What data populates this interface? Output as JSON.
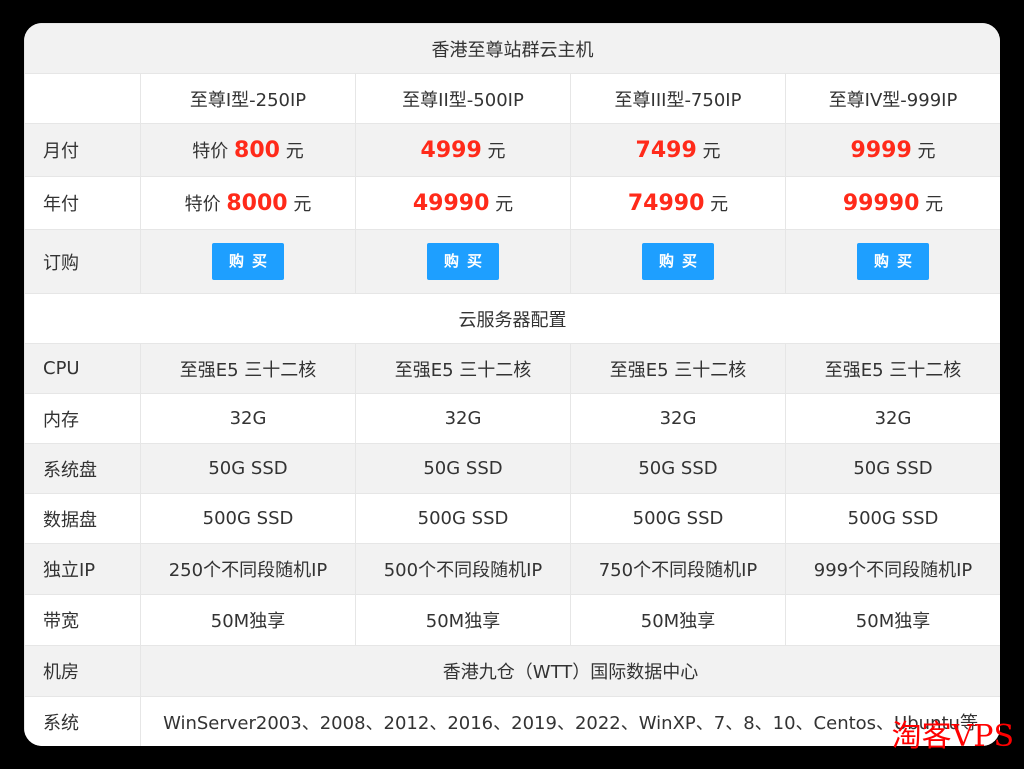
{
  "header": {
    "title": "香港至尊站群云主机"
  },
  "plans": [
    {
      "name": "至尊I型-250IP",
      "monthly_prefix": "特价",
      "monthly": "800",
      "yearly_prefix": "特价",
      "yearly": "8000",
      "buy": "购买",
      "cpu": "至强E5 三十二核",
      "ram": "32G",
      "sysdisk": "50G SSD",
      "datadisk": "500G SSD",
      "ip": "250个不同段随机IP",
      "bw": "50M独享"
    },
    {
      "name": "至尊II型-500IP",
      "monthly_prefix": "",
      "monthly": "4999",
      "yearly_prefix": "",
      "yearly": "49990",
      "buy": "购买",
      "cpu": "至强E5 三十二核",
      "ram": "32G",
      "sysdisk": "50G SSD",
      "datadisk": "500G SSD",
      "ip": "500个不同段随机IP",
      "bw": "50M独享"
    },
    {
      "name": "至尊III型-750IP",
      "monthly_prefix": "",
      "monthly": "7499",
      "yearly_prefix": "",
      "yearly": "74990",
      "buy": "购买",
      "cpu": "至强E5 三十二核",
      "ram": "32G",
      "sysdisk": "50G SSD",
      "datadisk": "500G SSD",
      "ip": "750个不同段随机IP",
      "bw": "50M独享"
    },
    {
      "name": "至尊IV型-999IP",
      "monthly_prefix": "",
      "monthly": "9999",
      "yearly_prefix": "",
      "yearly": "99990",
      "buy": "购买",
      "cpu": "至强E5 三十二核",
      "ram": "32G",
      "sysdisk": "50G SSD",
      "datadisk": "500G SSD",
      "ip": "999个不同段随机IP",
      "bw": "50M独享"
    }
  ],
  "labels": {
    "monthly": "月付",
    "yearly": "年付",
    "order": "订购",
    "cpu": "CPU",
    "ram": "内存",
    "sysdisk": "系统盘",
    "datadisk": "数据盘",
    "ip": "独立IP",
    "bw": "带宽",
    "dc": "机房",
    "os": "系统"
  },
  "currency": "元",
  "config_title": "云服务器配置",
  "datacenter": "香港九仓（WTT）国际数据中心",
  "os_list": "WinServer2003、2008、2012、2016、2019、2022、WinXP、7、8、10、Centos、Ubuntu等",
  "watermark": "淘客VPS",
  "colors": {
    "price": "#ff2a1a",
    "button": "#1e9fff",
    "row_gray": "#f2f2f2"
  }
}
